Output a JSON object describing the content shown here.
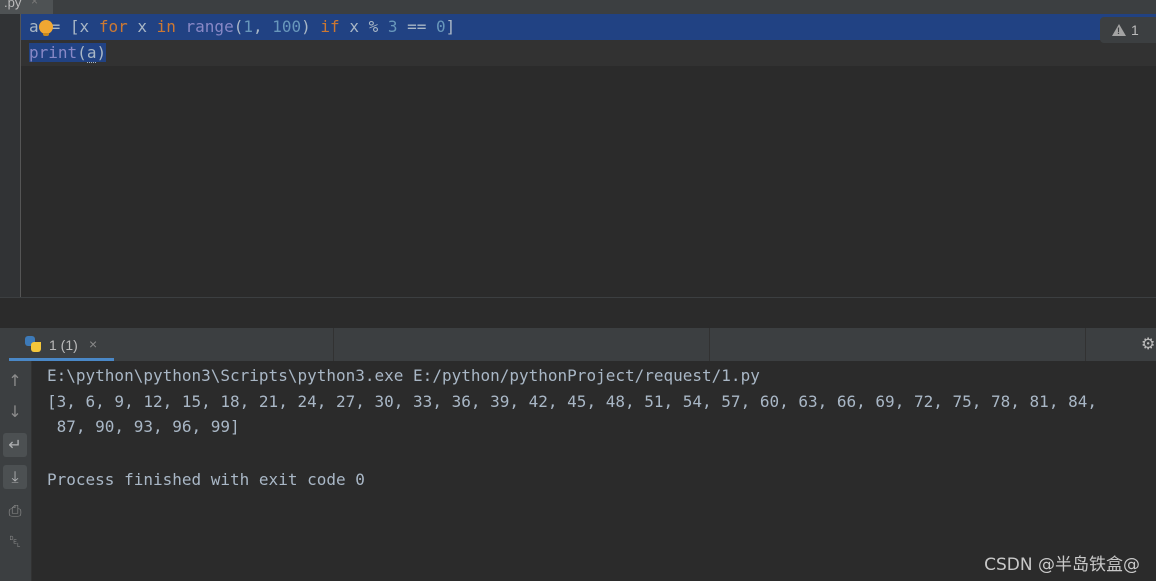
{
  "editor": {
    "tab": {
      "label": ".py",
      "close": "×"
    },
    "lines": [
      {
        "var": "a",
        "p1": "= [x ",
        "kw_for": "for",
        "p2": " x ",
        "kw_in": "in",
        "p3": " ",
        "builtin_range": "range",
        "p4": "(",
        "n1": "1",
        "p5": ", ",
        "n2": "100",
        "p6": ") ",
        "kw_if": "if",
        "p7": " x % ",
        "n3": "3",
        "p8": " == ",
        "n4": "0",
        "p9": "]"
      },
      {
        "builtin_print": "print",
        "p1": "(",
        "arg": "a",
        "p2": ")"
      }
    ],
    "inspection": {
      "icon": "warning-icon",
      "count": "1"
    }
  },
  "run": {
    "tab": {
      "label": "1 (1)",
      "close": "×"
    },
    "toolbar": [
      {
        "name": "up-arrow-icon",
        "glyph": "↑"
      },
      {
        "name": "down-arrow-icon",
        "glyph": "↓"
      },
      {
        "name": "soft-wrap-icon",
        "glyph": "↵"
      },
      {
        "name": "scroll-to-end-icon",
        "glyph": "⤓"
      },
      {
        "name": "print-icon",
        "glyph": "⎙"
      },
      {
        "name": "trash-icon",
        "glyph": "␡"
      }
    ],
    "console": [
      "E:\\python\\python3\\Scripts\\python3.exe E:/python/pythonProject/request/1.py",
      "[3, 6, 9, 12, 15, 18, 21, 24, 27, 30, 33, 36, 39, 42, 45, 48, 51, 54, 57, 60, 63, 66, 69, 72, 75, 78, 81, 84,",
      " 87, 90, 93, 96, 99]",
      "",
      "Process finished with exit code 0"
    ]
  },
  "watermark": "CSDN @半岛铁盒@"
}
